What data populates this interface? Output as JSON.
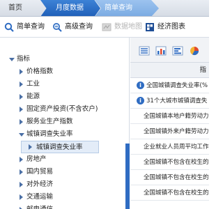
{
  "tabs": {
    "home": "首页",
    "monthly": "月度数据",
    "query": "简单查询"
  },
  "toolbar": {
    "simple_query": "简单查询",
    "advanced_query": "高级查询",
    "data_map": "数据地图",
    "economic_chart": "经济图表"
  },
  "sidebar": {
    "root": "指标",
    "items": [
      "价格指数",
      "工业",
      "能源",
      "固定资产投资(不含农户)",
      "服务业生产指数",
      "城镇调查失业率",
      "城镇调查失业率",
      "房地产",
      "国内贸易",
      "对外经济",
      "交通运输",
      "邮电通信"
    ]
  },
  "main": {
    "header": "指",
    "rows": [
      "全国城镇调查失业率(%",
      "31个大城市城镇调查失",
      "全国城镇本地户籍劳动力",
      "全国城镇外来户籍劳动力",
      "企业就业人员周平均工作",
      "全国城镇不包含在校生的",
      "全国城镇不包含在校生的",
      "全国城镇不包含在校生的"
    ]
  },
  "colors": {
    "accent": "#1f5fb8",
    "selected_bg": "#e3ecf8",
    "scrollbar": "#2f6cc2"
  }
}
